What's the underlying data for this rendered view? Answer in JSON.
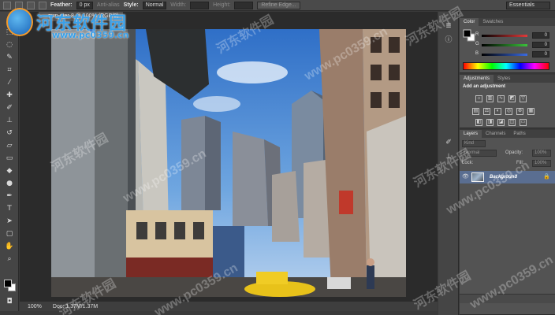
{
  "options_bar": {
    "feather_label": "Feather:",
    "feather_value": "0 px",
    "antialias_label": "Anti-alias",
    "style_label": "Style:",
    "style_value": "Normal",
    "width_label": "Width:",
    "height_label": "Height:",
    "refine_edge_label": "Refine Edge...",
    "workspace_value": "Essentials"
  },
  "document": {
    "tab_title": "...own-ster-8 @ 100% (RGB/8)",
    "zoom": "100%",
    "doc_size": "Doc: 1.37M/1.37M"
  },
  "color_panel": {
    "tabs": [
      "Color",
      "Swatches"
    ],
    "channels": [
      {
        "label": "R",
        "value": "0",
        "color": "#e23b3b"
      },
      {
        "label": "G",
        "value": "0",
        "color": "#3bc23b"
      },
      {
        "label": "B",
        "value": "0",
        "color": "#3b6be2"
      }
    ]
  },
  "adjustments_panel": {
    "tabs": [
      "Adjustments",
      "Styles"
    ],
    "title": "Add an adjustment"
  },
  "layers_panel": {
    "tabs": [
      "Layers",
      "Channels",
      "Paths"
    ],
    "kind_label": "Kind",
    "blend_mode": "Normal",
    "opacity_label": "Opacity:",
    "opacity_value": "100%",
    "lock_label": "Lock:",
    "fill_label": "Fill:",
    "fill_value": "100%",
    "layers": [
      {
        "name": "Background",
        "visible": true,
        "locked": true,
        "selected": true
      }
    ]
  },
  "watermark": {
    "brand": "河东软件园",
    "url": "www.pc0359.cn",
    "repeat": "河东软件园",
    "repeat_url": "www.pc0359.cn"
  },
  "colors": {
    "selected_layer": "#5a6e91",
    "brand_blue": "#3aa0e8"
  }
}
